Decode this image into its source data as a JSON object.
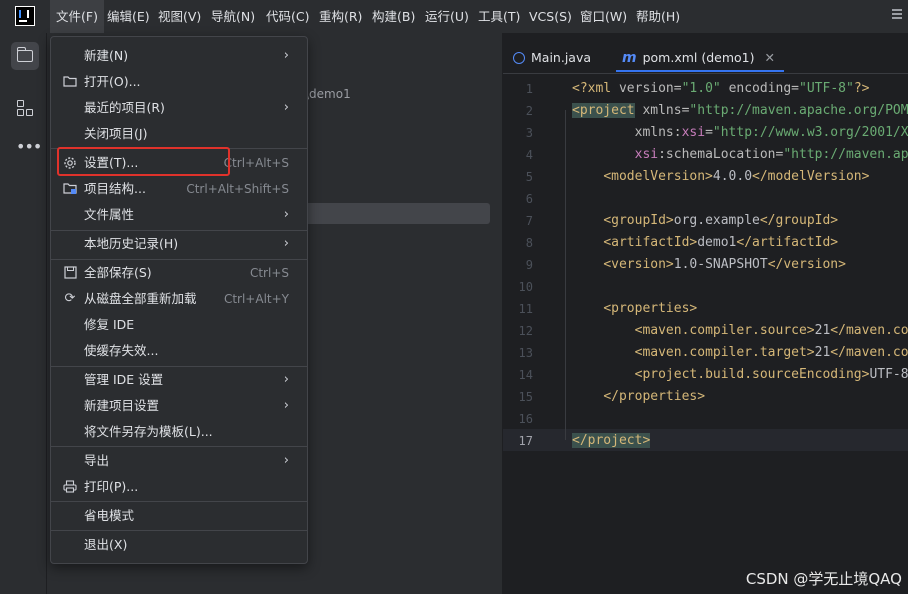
{
  "menubar": {
    "items": [
      "文件(F)",
      "编辑(E)",
      "视图(V)",
      "导航(N)",
      "代码(C)",
      "重构(R)",
      "构建(B)",
      "运行(U)",
      "工具(T)",
      "VCS(S)",
      "窗口(W)",
      "帮助(H)"
    ]
  },
  "project_panel": {
    "path_fragment": "\\demo1"
  },
  "editor": {
    "tabs": [
      {
        "label": "Main.java",
        "icon": "java-class-icon"
      },
      {
        "label": "pom.xml (demo1)",
        "icon": "maven-icon",
        "active": true
      }
    ],
    "line_numbers": [
      "1",
      "2",
      "3",
      "4",
      "5",
      "6",
      "7",
      "8",
      "9",
      "10",
      "11",
      "12",
      "13",
      "14",
      "15",
      "16",
      "17"
    ],
    "current_line": "17"
  },
  "file_menu": {
    "items": [
      {
        "label": "新建(N)",
        "submenu": true,
        "icon": ""
      },
      {
        "label": "打开(O)...",
        "icon": "folder-icon"
      },
      {
        "label": "最近的项目(R)",
        "submenu": true
      },
      {
        "label": "关闭项目(J)"
      },
      {
        "label": "设置(T)...",
        "shortcut": "Ctrl+Alt+S",
        "icon": "gear-icon"
      },
      {
        "label": "项目结构...",
        "shortcut": "Ctrl+Alt+Shift+S",
        "icon": "project-structure-icon"
      },
      {
        "label": "文件属性",
        "submenu": true
      },
      {
        "label": "本地历史记录(H)",
        "submenu": true
      },
      {
        "label": "全部保存(S)",
        "shortcut": "Ctrl+S",
        "icon": "save-icon"
      },
      {
        "label": "从磁盘全部重新加载",
        "shortcut": "Ctrl+Alt+Y",
        "icon": "reload-icon"
      },
      {
        "label": "修复 IDE"
      },
      {
        "label": "使缓存失效..."
      },
      {
        "label": "管理 IDE 设置",
        "submenu": true
      },
      {
        "label": "新建项目设置",
        "submenu": true
      },
      {
        "label": "将文件另存为模板(L)..."
      },
      {
        "label": "导出",
        "submenu": true
      },
      {
        "label": "打印(P)...",
        "icon": "print-icon"
      },
      {
        "label": "省电模式"
      },
      {
        "label": "退出(X)"
      }
    ]
  },
  "colors": {
    "highlight_box": "#e0322b",
    "accent": "#3574f0"
  },
  "watermark": "CSDN @学无止境QAQ"
}
